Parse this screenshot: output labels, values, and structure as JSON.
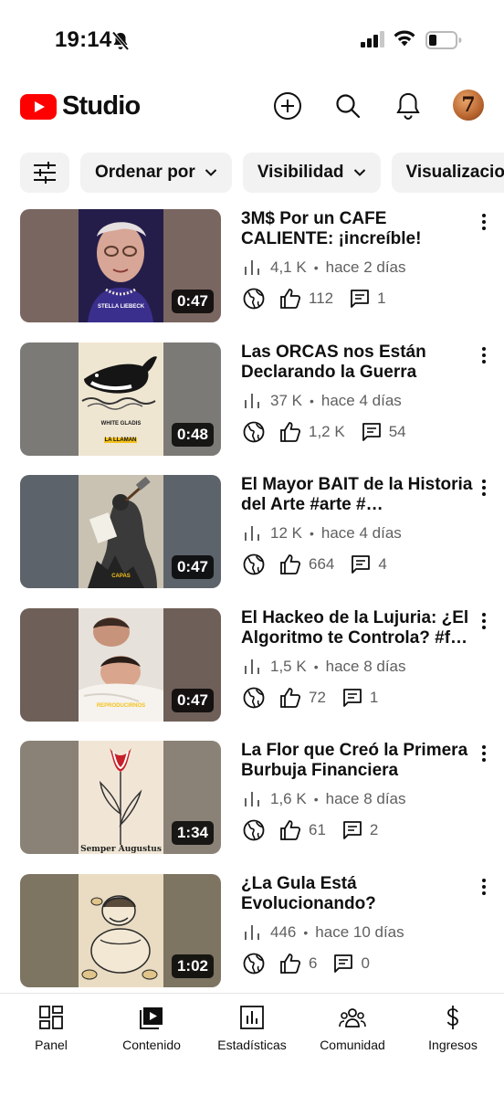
{
  "status_bar": {
    "time": "19:14"
  },
  "header": {
    "logo_text": "Studio",
    "avatar_initial": "7"
  },
  "filters": {
    "sort_label": "Ordenar por",
    "visibility_label": "Visibilidad",
    "views_label": "Visualizaciones"
  },
  "videos": [
    {
      "title": "3M$ Por un CAFE CALIENTE: ¡increíble!",
      "duration": "0:47",
      "views": "4,1 K",
      "age": "hace 2 días",
      "likes": "112",
      "comments": "1",
      "caption": "STELLA LIEBECK"
    },
    {
      "title": "Las ORCAS nos Están Declarando la Guerra",
      "duration": "0:48",
      "views": "37 K",
      "age": "hace 4 días",
      "likes": "1,2 K",
      "comments": "54",
      "caption": "WHITE GLADIS",
      "caption2": "LA LLAMAN"
    },
    {
      "title": "El Mayor BAIT de la Historia del Arte  #arte  #…",
      "duration": "0:47",
      "views": "12 K",
      "age": "hace 4 días",
      "likes": "664",
      "comments": "4",
      "caption": "CAPAS"
    },
    {
      "title": "El Hackeo de la Lujuria: ¿El Algoritmo te Controla? #f…",
      "duration": "0:47",
      "views": "1,5 K",
      "age": "hace 8 días",
      "likes": "72",
      "comments": "1",
      "caption": "REPRODUCIRNOS"
    },
    {
      "title": "La Flor que Creó la Primera Burbuja Financiera",
      "duration": "1:34",
      "views": "1,6 K",
      "age": "hace 8 días",
      "likes": "61",
      "comments": "2",
      "caption": "Semper Augustus"
    },
    {
      "title": "¿La Gula Está Evolucionando?",
      "duration": "1:02",
      "views": "446",
      "age": "hace 10 días",
      "likes": "6",
      "comments": "0"
    }
  ],
  "bottom_nav": {
    "panel": "Panel",
    "content": "Contenido",
    "stats": "Estadísticas",
    "community": "Comunidad",
    "revenue": "Ingresos"
  },
  "colors": {
    "brand_red": "#ff0000",
    "chip_bg": "#f2f2f2",
    "meta_gray": "#606060"
  }
}
